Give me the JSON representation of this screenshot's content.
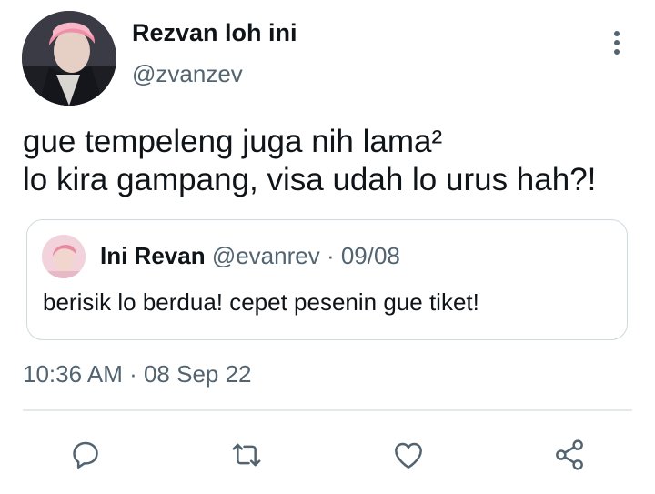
{
  "tweet": {
    "author": {
      "display_name": "Rezvan loh ini",
      "handle": "@zvanzev",
      "avatar": "profile-photo"
    },
    "text_lines": [
      "gue tempeleng juga nih lama²",
      "lo kira gampang, visa udah lo urus hah?!"
    ],
    "quote": {
      "author_name": "Ini Revan",
      "meta": "@evanrev · 09/08",
      "text": "berisik lo berdua! cepet pesenin gue tiket!",
      "avatar": "profile-photo"
    },
    "timestamp": "10:36 AM · 08 Sep 22"
  },
  "actions": [
    {
      "name": "reply",
      "icon": "speech-bubble-icon"
    },
    {
      "name": "retweet",
      "icon": "retweet-arrows-icon"
    },
    {
      "name": "like",
      "icon": "heart-icon"
    },
    {
      "name": "share",
      "icon": "share-nodes-icon"
    }
  ],
  "colors": {
    "text_primary": "#0f1419",
    "text_secondary": "#536471",
    "border": "#cfd9de"
  }
}
